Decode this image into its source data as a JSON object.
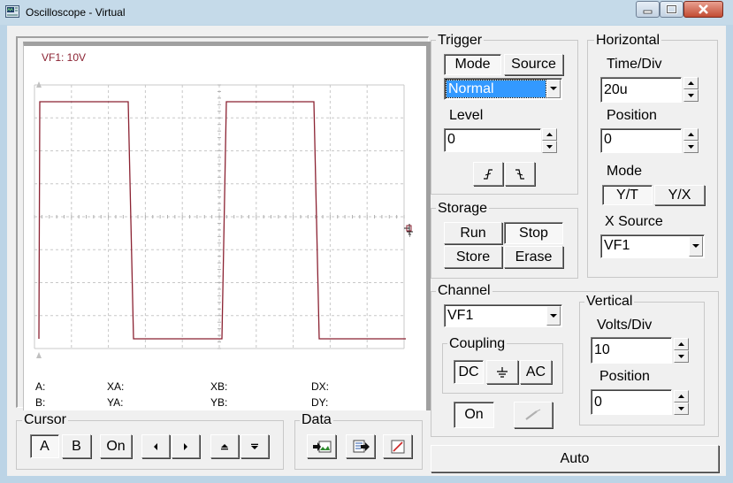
{
  "window": {
    "title": "Oscilloscope - Virtual",
    "icon": "oscilloscope-app-icon"
  },
  "scope": {
    "channel_label": "VF1: 10V",
    "trace_color": "#8b2232",
    "readouts": {
      "a": "A:",
      "b": "B:",
      "xa": "XA:",
      "ya": "YA:",
      "xb": "XB:",
      "yb": "YB:",
      "dx": "DX:",
      "dy": "DY:"
    }
  },
  "trigger": {
    "title": "Trigger",
    "mode_tab": "Mode",
    "source_tab": "Source",
    "mode_value": "Normal",
    "level_label": "Level",
    "level_value": "0",
    "rising_edge_icon": "rising-edge-icon",
    "falling_edge_icon": "falling-edge-icon"
  },
  "horizontal": {
    "title": "Horizontal",
    "time_div_label": "Time/Div",
    "time_div_value": "20u",
    "position_label": "Position",
    "position_value": "0",
    "mode_label": "Mode",
    "yt_button": "Y/T",
    "yx_button": "Y/X",
    "xsource_label": "X Source",
    "xsource_value": "VF1"
  },
  "storage": {
    "title": "Storage",
    "run": "Run",
    "stop": "Stop",
    "store": "Store",
    "erase": "Erase"
  },
  "channel": {
    "title": "Channel",
    "value": "VF1",
    "coupling_title": "Coupling",
    "dc": "DC",
    "gnd_icon": "ground-icon",
    "ac": "AC",
    "on_button": "On",
    "probe_icon": "probe-icon"
  },
  "vertical": {
    "title": "Vertical",
    "volts_div_label": "Volts/Div",
    "volts_div_value": "10",
    "position_label": "Position",
    "position_value": "0"
  },
  "cursor": {
    "title": "Cursor",
    "a": "A",
    "b": "B",
    "on": "On"
  },
  "data": {
    "title": "Data"
  },
  "auto_button": "Auto"
}
